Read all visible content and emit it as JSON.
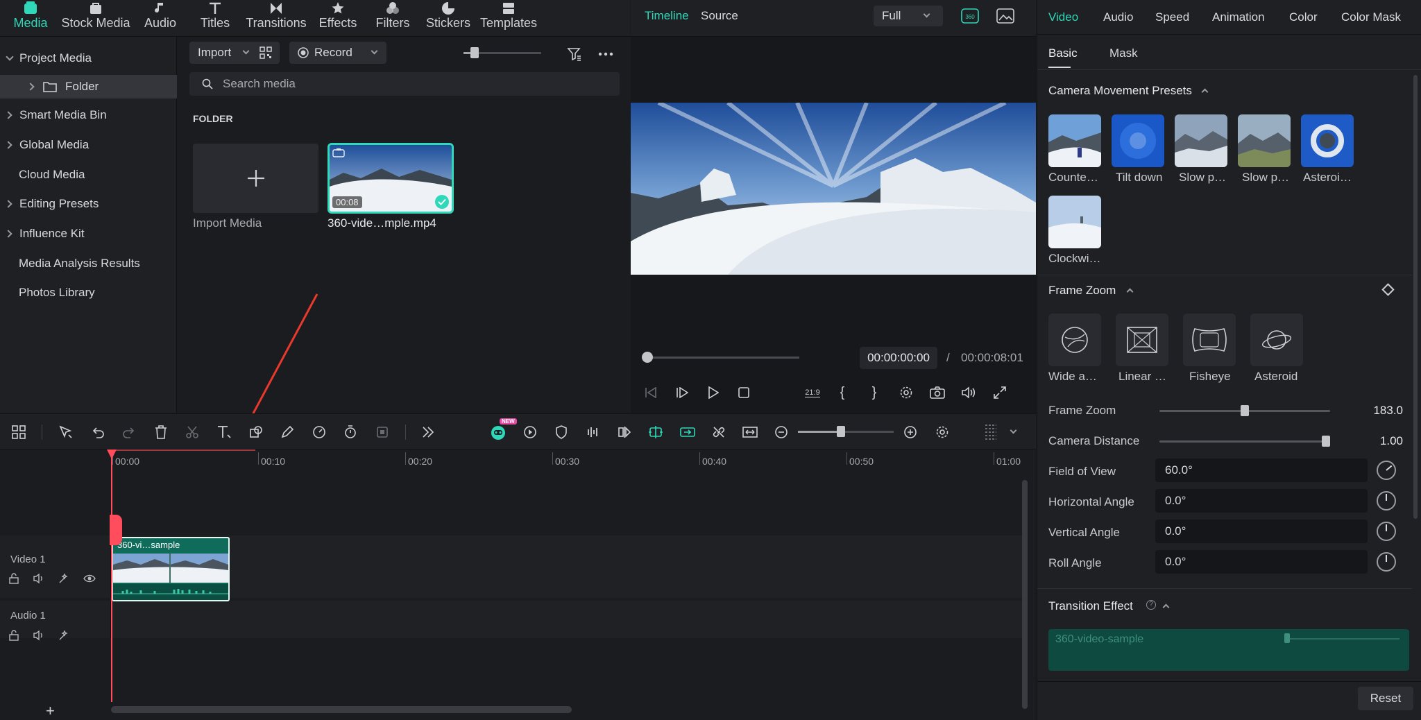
{
  "top_tabs": [
    {
      "label": "Media",
      "icon": "media-icon",
      "active": true
    },
    {
      "label": "Stock Media",
      "icon": "stock-media-icon"
    },
    {
      "label": "Audio",
      "icon": "music-note-icon"
    },
    {
      "label": "Titles",
      "icon": "title-t-icon"
    },
    {
      "label": "Transitions",
      "icon": "transitions-icon"
    },
    {
      "label": "Effects",
      "icon": "effects-icon"
    },
    {
      "label": "Filters",
      "icon": "filters-icon"
    },
    {
      "label": "Stickers",
      "icon": "stickers-icon"
    },
    {
      "label": "Templates",
      "icon": "templates-icon"
    }
  ],
  "sidebar": {
    "items": [
      {
        "label": "Project Media",
        "expanded": true
      },
      {
        "label": "Folder",
        "selected": true
      },
      {
        "label": "Smart Media Bin"
      },
      {
        "label": "Global Media"
      },
      {
        "label": "Cloud Media"
      },
      {
        "label": "Editing Presets"
      },
      {
        "label": "Influence Kit"
      },
      {
        "label": "Media Analysis Results"
      },
      {
        "label": "Photos Library"
      }
    ]
  },
  "media": {
    "import_label": "Import",
    "record_label": "Record",
    "search_placeholder": "Search media",
    "folder_heading": "FOLDER",
    "import_tile_label": "Import Media",
    "clip": {
      "name": "360-vide…mple.mp4",
      "duration": "00:08"
    }
  },
  "preview": {
    "tabs": [
      "Timeline",
      "Source"
    ],
    "quality": "Full",
    "current_time": "00:00:00:00",
    "separator": "/",
    "total_time": "00:00:08:01",
    "aspect_label": "21:9",
    "progress": 0
  },
  "props": {
    "tabs": [
      "Video",
      "Audio",
      "Speed",
      "Animation",
      "Color",
      "Color Mask"
    ],
    "subtabs": [
      "Basic",
      "Mask"
    ],
    "camera_presets_title": "Camera Movement Presets",
    "presets": [
      "Counte…",
      "Tilt down",
      "Slow p…",
      "Slow p…",
      "Asteroi…",
      "Clockwi…"
    ],
    "frame_zoom_title": "Frame Zoom",
    "zoom_modes": [
      "Wide a…",
      "Linear …",
      "Fisheye",
      "Asteroid"
    ],
    "frame_zoom_label": "Frame Zoom",
    "frame_zoom_value": "183.0",
    "frame_zoom_level": 0.5,
    "camera_distance_label": "Camera Distance",
    "camera_distance_value": "1.00",
    "camera_distance_level": 1.0,
    "fov_label": "Field of View",
    "fov_value": "60.0°",
    "h_angle_label": "Horizontal Angle",
    "h_angle_value": "0.0°",
    "v_angle_label": "Vertical Angle",
    "v_angle_value": "0.0°",
    "roll_label": "Roll Angle",
    "roll_value": "0.0°",
    "transition_title": "Transition Effect",
    "transition_clip": "360-video-sample",
    "reset_label": "Reset"
  },
  "timeline": {
    "ruler": [
      "00:00",
      "00:10",
      "00:20",
      "00:30",
      "00:40",
      "00:50",
      "01:00"
    ],
    "tracks": [
      {
        "label": "Video 1"
      },
      {
        "label": "Audio 1"
      }
    ],
    "clip_label": "360-vi…sample",
    "new_badge": "NEW"
  },
  "colors": {
    "accent": "#2fd8b8",
    "playhead": "#ff4d5e",
    "arrow": "#e8392c"
  }
}
